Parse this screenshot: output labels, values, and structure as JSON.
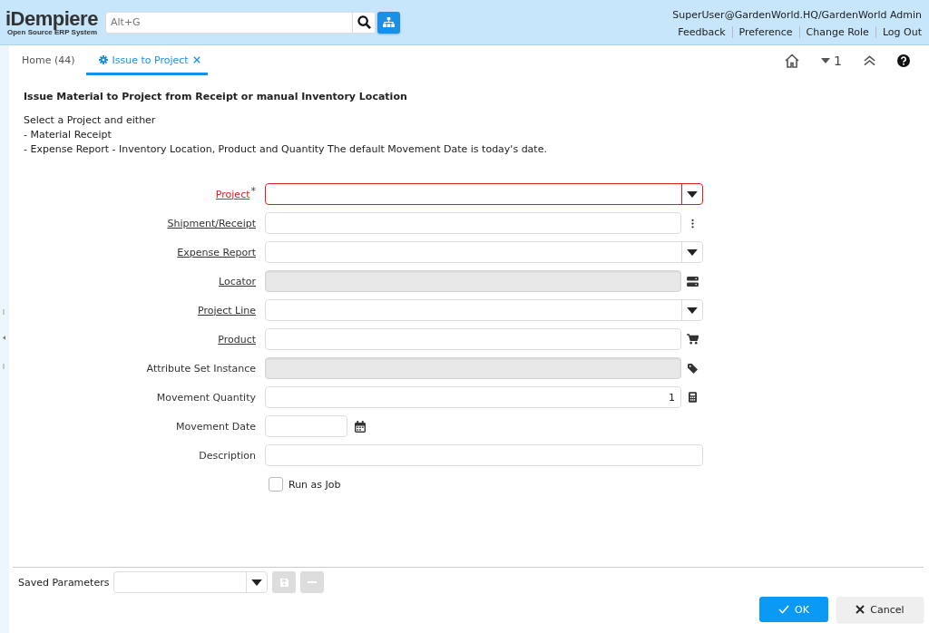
{
  "header": {
    "logo": "iDempiere",
    "tagline": "Open Source ERP System",
    "search": {
      "placeholder": "Alt+G"
    },
    "user": "SuperUser@GardenWorld.HQ/GardenWorld Admin",
    "links": [
      "Feedback",
      "Preference",
      "Change Role",
      "Log Out"
    ]
  },
  "tabs": [
    {
      "label": "Home (44)",
      "selected": false,
      "closable": false
    },
    {
      "label": "Issue to Project",
      "selected": true,
      "closable": true
    }
  ],
  "tab_toolbar": {
    "count": "1"
  },
  "process": {
    "title": "Issue Material to Project from Receipt or manual Inventory Location",
    "description": [
      "Select a Project and either",
      "- Material Receipt",
      "- Expense Report - Inventory Location, Product and Quantity The default Movement Date is today's date."
    ]
  },
  "fields": [
    {
      "label": "Project",
      "required_mark": "*",
      "kind": "combo",
      "link": true,
      "mandatory": true,
      "disabled": false
    },
    {
      "label": "Shipment/Receipt",
      "kind": "record",
      "link": true,
      "mandatory": false,
      "disabled": false
    },
    {
      "label": "Expense Report",
      "kind": "combo",
      "link": true,
      "mandatory": false,
      "disabled": false
    },
    {
      "label": "Locator",
      "kind": "locator",
      "link": true,
      "mandatory": false,
      "disabled": true
    },
    {
      "label": "Project Line",
      "kind": "combo",
      "link": true,
      "mandatory": false,
      "disabled": false
    },
    {
      "label": "Product",
      "kind": "product",
      "link": true,
      "mandatory": false,
      "disabled": false
    },
    {
      "label": "Attribute Set Instance",
      "kind": "attribute",
      "link": false,
      "mandatory": false,
      "disabled": true
    },
    {
      "label": "Movement Quantity",
      "kind": "quantity",
      "value": "1",
      "link": false,
      "mandatory": false,
      "disabled": false
    },
    {
      "label": "Movement Date",
      "kind": "date",
      "link": false,
      "mandatory": false,
      "disabled": false
    },
    {
      "label": "Description",
      "kind": "text",
      "link": false,
      "mandatory": false,
      "disabled": false
    }
  ],
  "run_as_job": {
    "label": "Run as Job",
    "checked": false
  },
  "footer": {
    "saved_parameters": "Saved Parameters",
    "buttons": [
      {
        "label": "OK",
        "kind": "ok"
      },
      {
        "label": "Cancel",
        "kind": "cancel"
      }
    ]
  }
}
